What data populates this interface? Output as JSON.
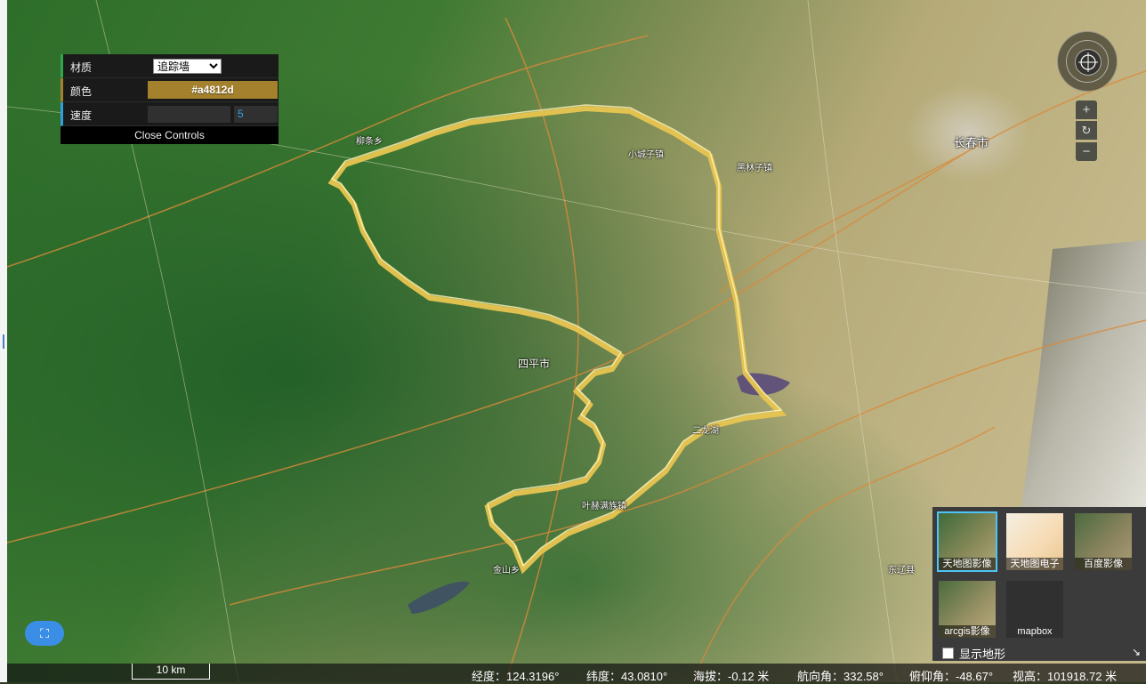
{
  "controls": {
    "material_label": "材质",
    "material_value": "追踪墙",
    "color_label": "颜色",
    "color_value": "#a4812d",
    "speed_label": "速度",
    "speed_value": "5",
    "close_label": "Close Controls"
  },
  "navigation": {
    "compass_icon": "compass-icon",
    "zoom_in": "+",
    "reset": "↻",
    "zoom_out": "−"
  },
  "basemaps": {
    "items": [
      {
        "label": "天地图影像",
        "selected": true
      },
      {
        "label": "天地图电子",
        "selected": false
      },
      {
        "label": "百度影像",
        "selected": false
      },
      {
        "label": "arcgis影像",
        "selected": false
      },
      {
        "label": "mapbox",
        "selected": false
      }
    ],
    "terrain_label": "显示地形"
  },
  "fullscreen": {
    "icon": "fullscreen-icon",
    "glyph": "⛶"
  },
  "status": {
    "scale": "10 km",
    "longitude": "经度：124.3196°",
    "latitude": "纬度：43.0810°",
    "altitude": "海拔：-0.12 米",
    "heading": "航向角：332.58°",
    "pitch": "俯仰角：-48.67°",
    "view_height": "视高：101918.72 米"
  },
  "map_labels": {
    "changchun": "长春市",
    "sipingshi": "四平市",
    "xiaochengzi": "小城子镇",
    "heilinzi": "黑林子镇",
    "liushu": "柳条乡",
    "dayang": "二龙湖",
    "yiye": "叶赫满族镇",
    "jinhua": "金山乡",
    "dongliao": "东辽县"
  },
  "colors": {
    "wall": "#e8c550",
    "accent": "#a4812d",
    "select": "#4fc3f7"
  }
}
